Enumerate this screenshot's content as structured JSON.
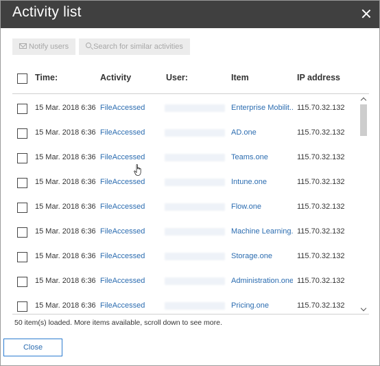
{
  "dialog": {
    "title": "Activity list",
    "close_icon": "close-icon"
  },
  "toolbar": {
    "notify_label": "Notify users",
    "notify_icon": "mail-icon",
    "search_label": "Search for similar activities",
    "search_icon": "search-icon"
  },
  "table": {
    "headers": {
      "time": "Time:",
      "activity": "Activity",
      "user": "User:",
      "item": "Item",
      "ip": "IP address"
    },
    "rows": [
      {
        "time": "15 Mar. 2018 6:36...",
        "activity": "FileAccessed",
        "item": "Enterprise Mobilit...",
        "ip": "115.70.32.132"
      },
      {
        "time": "15 Mar. 2018 6:36...",
        "activity": "FileAccessed",
        "item": "AD.one",
        "ip": "115.70.32.132"
      },
      {
        "time": "15 Mar. 2018 6:36...",
        "activity": "FileAccessed",
        "item": "Teams.one",
        "ip": "115.70.32.132"
      },
      {
        "time": "15 Mar. 2018 6:36...",
        "activity": "FileAccessed",
        "item": "Intune.one",
        "ip": "115.70.32.132"
      },
      {
        "time": "15 Mar. 2018 6:36...",
        "activity": "FileAccessed",
        "item": "Flow.one",
        "ip": "115.70.32.132"
      },
      {
        "time": "15 Mar. 2018 6:36...",
        "activity": "FileAccessed",
        "item": "Machine Learning...",
        "ip": "115.70.32.132"
      },
      {
        "time": "15 Mar. 2018 6:36...",
        "activity": "FileAccessed",
        "item": "Storage.one",
        "ip": "115.70.32.132"
      },
      {
        "time": "15 Mar. 2018 6:36...",
        "activity": "FileAccessed",
        "item": "Administration.one",
        "ip": "115.70.32.132"
      },
      {
        "time": "15 Mar. 2018 6:36...",
        "activity": "FileAccessed",
        "item": "Pricing.one",
        "ip": "115.70.32.132"
      }
    ]
  },
  "status_text": "50 item(s) loaded. More items available, scroll down to see more.",
  "footer": {
    "close_label": "Close"
  },
  "colors": {
    "titlebar": "#404040",
    "link": "#2b6cb0",
    "button_border": "#2b7bd0"
  }
}
